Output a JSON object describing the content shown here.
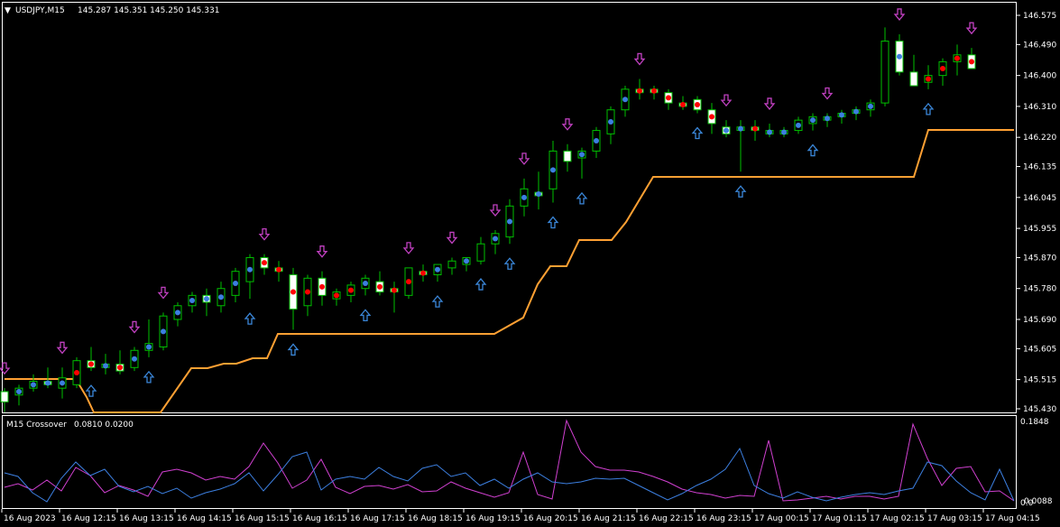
{
  "header": {
    "symbol_tf": "USDJPY,M15",
    "ohlc": "145.287 145.351 145.250 145.331"
  },
  "indicator": {
    "title": "M15 Crossover",
    "values": "0.0810 0.0200",
    "scale_top": "0.1848",
    "scale_bottom": "0.0088",
    "scale_bottom2": "0.0"
  },
  "price_axis": [
    "146.575",
    "146.490",
    "146.400",
    "146.310",
    "146.220",
    "146.135",
    "146.045",
    "145.955",
    "145.870",
    "145.780",
    "145.690",
    "145.605",
    "145.515",
    "145.430"
  ],
  "time_axis": [
    "16 Aug 2023",
    "16 Aug 12:15",
    "16 Aug 13:15",
    "16 Aug 14:15",
    "16 Aug 15:15",
    "16 Aug 16:15",
    "16 Aug 17:15",
    "16 Aug 18:15",
    "16 Aug 19:15",
    "16 Aug 20:15",
    "16 Aug 21:15",
    "16 Aug 22:15",
    "16 Aug 23:15",
    "17 Aug 00:15",
    "17 Aug 01:15",
    "17 Aug 02:15",
    "17 Aug 03:15",
    "17 Aug 04:15"
  ],
  "colors": {
    "background": "#000000",
    "bull_candle": "#00c000",
    "bear_body": "#ffffff",
    "trail_line": "#ffa033",
    "dot_red": "#ff0000",
    "dot_blue": "#3c7fe0",
    "arrow_down": "#c040c0",
    "arrow_up": "#3a86d8",
    "ind_magenta": "#d040d0",
    "ind_blue": "#3c7fe0",
    "grid": "#ffffff"
  },
  "chart_data": {
    "type": "candlestick",
    "symbol": "USDJPY",
    "timeframe": "M15",
    "ylim": [
      145.43,
      146.575
    ],
    "candles": [
      [
        145.48,
        145.49,
        145.42,
        145.45
      ],
      [
        145.47,
        145.5,
        145.44,
        145.49
      ],
      [
        145.49,
        145.53,
        145.48,
        145.51
      ],
      [
        145.51,
        145.55,
        145.49,
        145.5
      ],
      [
        145.49,
        145.55,
        145.46,
        145.52
      ],
      [
        145.5,
        145.58,
        145.49,
        145.57
      ],
      [
        145.57,
        145.61,
        145.54,
        145.55
      ],
      [
        145.55,
        145.59,
        145.53,
        145.56
      ],
      [
        145.56,
        145.6,
        145.53,
        145.54
      ],
      [
        145.55,
        145.61,
        145.54,
        145.6
      ],
      [
        145.6,
        145.69,
        145.58,
        145.62
      ],
      [
        145.61,
        145.71,
        145.6,
        145.7
      ],
      [
        145.69,
        145.74,
        145.67,
        145.73
      ],
      [
        145.73,
        145.77,
        145.71,
        145.76
      ],
      [
        145.76,
        145.78,
        145.7,
        145.74
      ],
      [
        145.73,
        145.8,
        145.71,
        145.78
      ],
      [
        145.76,
        145.84,
        145.74,
        145.83
      ],
      [
        145.8,
        145.88,
        145.75,
        145.87
      ],
      [
        145.87,
        145.88,
        145.82,
        145.84
      ],
      [
        145.84,
        145.86,
        145.8,
        145.83
      ],
      [
        145.82,
        145.84,
        145.66,
        145.72
      ],
      [
        145.73,
        145.82,
        145.7,
        145.81
      ],
      [
        145.81,
        145.83,
        145.73,
        145.76
      ],
      [
        145.75,
        145.78,
        145.73,
        145.77
      ],
      [
        145.76,
        145.8,
        145.74,
        145.79
      ],
      [
        145.78,
        145.82,
        145.76,
        145.81
      ],
      [
        145.8,
        145.83,
        145.76,
        145.77
      ],
      [
        145.78,
        145.8,
        145.71,
        145.77
      ],
      [
        145.76,
        145.84,
        145.75,
        145.84
      ],
      [
        145.83,
        145.85,
        145.8,
        145.82
      ],
      [
        145.82,
        145.85,
        145.8,
        145.85
      ],
      [
        145.84,
        145.87,
        145.82,
        145.86
      ],
      [
        145.85,
        145.87,
        145.83,
        145.87
      ],
      [
        145.86,
        145.93,
        145.85,
        145.91
      ],
      [
        145.91,
        145.95,
        145.88,
        145.94
      ],
      [
        145.93,
        146.04,
        145.91,
        146.02
      ],
      [
        146.02,
        146.1,
        145.99,
        146.07
      ],
      [
        146.06,
        146.12,
        146.01,
        146.05
      ],
      [
        146.07,
        146.21,
        146.03,
        146.18
      ],
      [
        146.18,
        146.2,
        146.12,
        146.15
      ],
      [
        146.16,
        146.19,
        146.1,
        146.18
      ],
      [
        146.18,
        146.25,
        146.16,
        146.24
      ],
      [
        146.23,
        146.31,
        146.2,
        146.3
      ],
      [
        146.3,
        146.37,
        146.28,
        146.36
      ],
      [
        146.36,
        146.39,
        146.33,
        146.35
      ],
      [
        146.36,
        146.37,
        146.33,
        146.35
      ],
      [
        146.35,
        146.36,
        146.3,
        146.32
      ],
      [
        146.32,
        146.34,
        146.3,
        146.31
      ],
      [
        146.33,
        146.34,
        146.29,
        146.3
      ],
      [
        146.3,
        146.32,
        146.23,
        146.26
      ],
      [
        146.25,
        146.27,
        146.22,
        146.23
      ],
      [
        146.24,
        146.27,
        146.12,
        146.25
      ],
      [
        146.25,
        146.27,
        146.21,
        146.24
      ],
      [
        146.23,
        146.26,
        146.22,
        146.24
      ],
      [
        146.23,
        146.25,
        146.22,
        146.24
      ],
      [
        146.24,
        146.28,
        146.23,
        146.27
      ],
      [
        146.26,
        146.29,
        146.24,
        146.28
      ],
      [
        146.27,
        146.29,
        146.25,
        146.28
      ],
      [
        146.28,
        146.3,
        146.26,
        146.29
      ],
      [
        146.29,
        146.31,
        146.27,
        146.3
      ],
      [
        146.3,
        146.33,
        146.28,
        146.32
      ],
      [
        146.32,
        146.54,
        146.31,
        146.5
      ],
      [
        146.5,
        146.52,
        146.4,
        146.41
      ],
      [
        146.41,
        146.46,
        146.37,
        146.37
      ],
      [
        146.38,
        146.43,
        146.36,
        146.4
      ],
      [
        146.4,
        146.45,
        146.37,
        146.44
      ],
      [
        146.44,
        146.49,
        146.4,
        146.46
      ],
      [
        146.46,
        146.48,
        146.42,
        146.42
      ]
    ]
  }
}
